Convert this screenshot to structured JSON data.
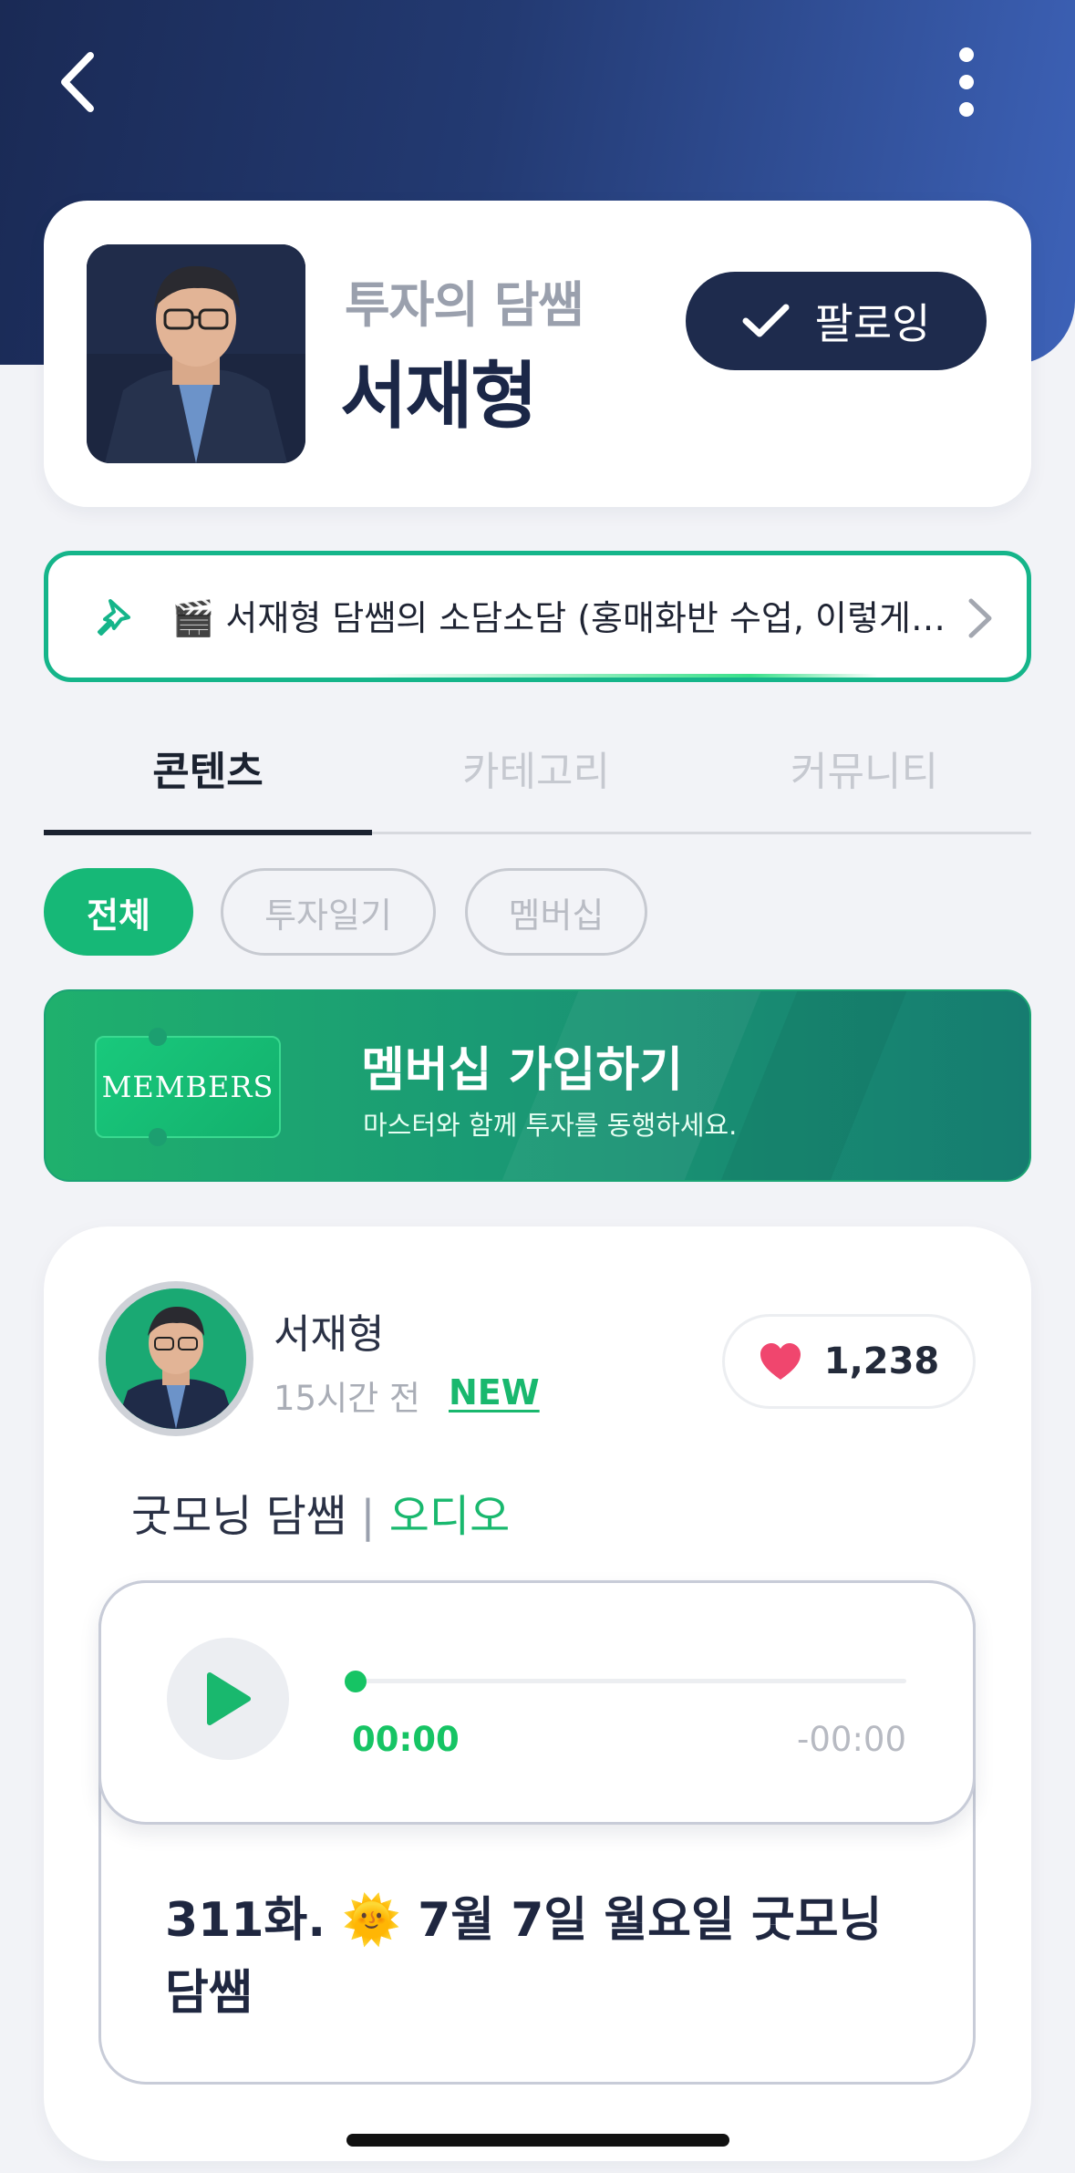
{
  "header": {
    "back_icon": "chevron-left-icon",
    "more_icon": "more-vertical-icon"
  },
  "profile": {
    "subtitle": "투자의 담쌤",
    "name": "서재형",
    "follow_label": "팔로잉",
    "follow_icon": "check-icon"
  },
  "notice": {
    "pin_icon": "pin-icon",
    "text": "🎬 서재형 담쌤의 소담소담 (홍매화반 수업, 이렇게 진행됩니다)"
  },
  "tabs": [
    {
      "label": "콘텐츠",
      "active": true
    },
    {
      "label": "카테고리",
      "active": false
    },
    {
      "label": "커뮤니티",
      "active": false
    }
  ],
  "filters": [
    {
      "label": "전체",
      "active": true
    },
    {
      "label": "투자일기",
      "active": false
    },
    {
      "label": "멤버십",
      "active": false
    }
  ],
  "members_banner": {
    "ticket_label": "MEMBERS",
    "title": "멤버십 가입하기",
    "subtitle": "마스터와 함께 투자를 동행하세요."
  },
  "post": {
    "author": "서재형",
    "time": "15시간 전",
    "new_badge": "NEW",
    "like_count": "1,238",
    "title_main": "굿모닝 담쌤",
    "title_sep": " | ",
    "title_category": "오디오",
    "player": {
      "current_time": "00:00",
      "remaining_time": "-00:00",
      "progress": 0
    },
    "episode_title": "311화. 🌞 7월 7일 월요일 굿모닝 담쌤"
  },
  "colors": {
    "brand_navy": "#1e2b4d",
    "brand_green": "#16b877",
    "notice_border": "#15b58a",
    "heart": "#f0466e"
  }
}
